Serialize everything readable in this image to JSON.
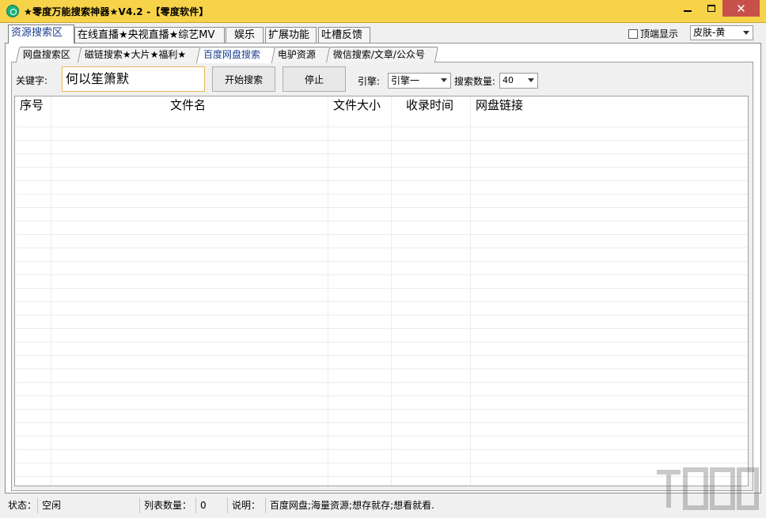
{
  "window": {
    "title": "★零度万能搜索神器★V4.2 -【零度软件】",
    "accent_color": "#f7d34a",
    "icon": "app-logo-icon"
  },
  "main_tabs": [
    {
      "label": "资源搜索区",
      "active": true
    },
    {
      "label": "在线直播★央视直播★综艺MV",
      "active": false
    },
    {
      "label": "娱乐",
      "active": false
    },
    {
      "label": "扩展功能",
      "active": false
    },
    {
      "label": "吐槽反馈",
      "active": false
    }
  ],
  "topmost": {
    "label": "顶端显示",
    "checked": false
  },
  "skin": {
    "selected": "皮肤-黄"
  },
  "sub_tabs": [
    {
      "label": "网盘搜索区",
      "active": false
    },
    {
      "label": "磁链搜索★大片★福利★",
      "active": false
    },
    {
      "label": "百度网盘搜索",
      "active": true
    },
    {
      "label": "电驴资源",
      "active": false
    },
    {
      "label": "微信搜索/文章/公众号",
      "active": false
    }
  ],
  "search": {
    "keyword_label": "关键字:",
    "keyword_value": "何以笙箫默",
    "start_label": "开始搜索",
    "stop_label": "停止",
    "engine_label": "引擎:",
    "engine_selected": "引擎一",
    "count_label": "搜索数量:",
    "count_selected": "40"
  },
  "table": {
    "columns": [
      "序号",
      "文件名",
      "文件大小",
      "收录时间",
      "网盘链接"
    ],
    "rows": []
  },
  "status": {
    "state_label": "状态：",
    "state_value": "空闲",
    "count_label": "列表数量：",
    "count_value": "0",
    "desc_label": "说明：",
    "desc_value": "百度网盘;海量资源;想存就存;想看就看."
  }
}
